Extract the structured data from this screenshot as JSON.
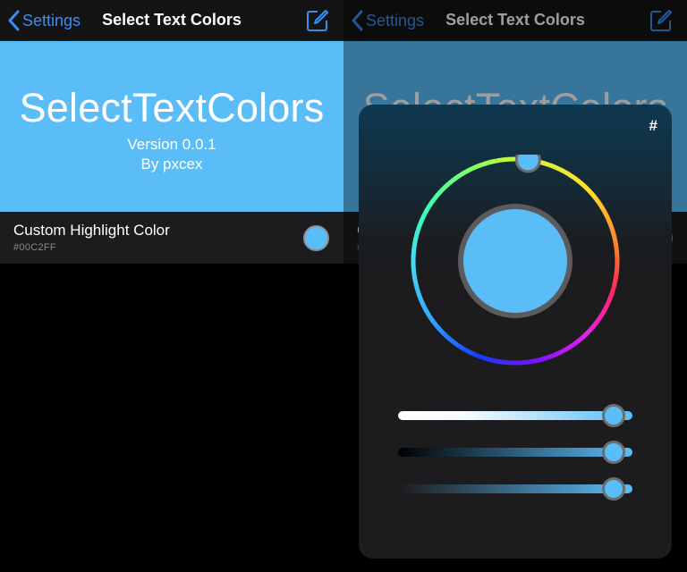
{
  "nav": {
    "back_label": "Settings",
    "title": "Select Text Colors"
  },
  "banner": {
    "title": "SelectTextColors",
    "version": "Version 0.0.1",
    "author": "By pxcex"
  },
  "setting": {
    "title": "Custom Highlight Color",
    "value": "#00C2FF"
  },
  "picker": {
    "hex_button": "#",
    "hue_position": 0.52,
    "sliders": [
      {
        "name": "saturation",
        "value": 0.92
      },
      {
        "name": "brightness",
        "value": 0.92
      },
      {
        "name": "alpha",
        "value": 0.92
      }
    ]
  },
  "colors": {
    "accent": "#5bbdf8",
    "link": "#3a8ef0",
    "background": "#000000",
    "cell": "#1c1c1e"
  },
  "icons": {
    "back": "chevron-left-icon",
    "compose": "compose-icon"
  }
}
